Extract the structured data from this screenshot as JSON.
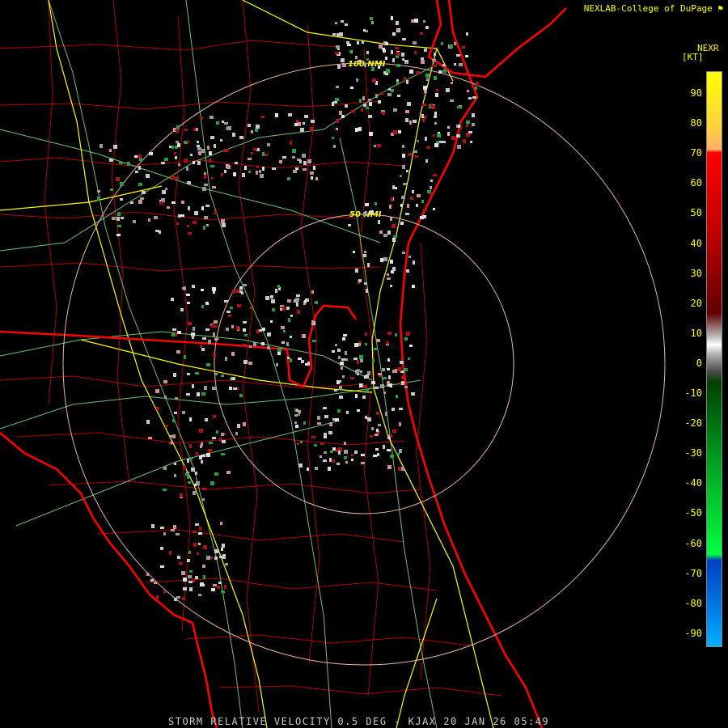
{
  "credit": "NEXLAB-College of DuPage",
  "credit_icon": "flag-icon",
  "product_line": "STORM RELATIVE VELOCITY 0.5 DEG - KJAX 20 JAN 26 05:49",
  "legend": {
    "title": "NEXR",
    "unit": "[KT]",
    "ticks": [
      "90",
      "80",
      "70",
      "60",
      "50",
      "40",
      "30",
      "20",
      "10",
      "0",
      "-10",
      "-20",
      "-30",
      "-40",
      "-50",
      "-60",
      "-70",
      "-80",
      "-90"
    ],
    "colors": {
      "top": "#ffff00",
      "orange": "#ffb366",
      "red": "#ff0000",
      "dark_red": "#600000",
      "gray": "#b8b8b8",
      "dark_green": "#004000",
      "green": "#00ff40",
      "blue": "#0040c0",
      "cyan": "#00b0ff"
    }
  },
  "range_rings": [
    {
      "label": "50 NMI"
    },
    {
      "label": "100 NMI"
    }
  ],
  "map_colors": {
    "coast": "#ff0000",
    "county": "#b00000",
    "highway": "#ffff00",
    "road": "#70c070",
    "ring": "#e8b8a0"
  }
}
